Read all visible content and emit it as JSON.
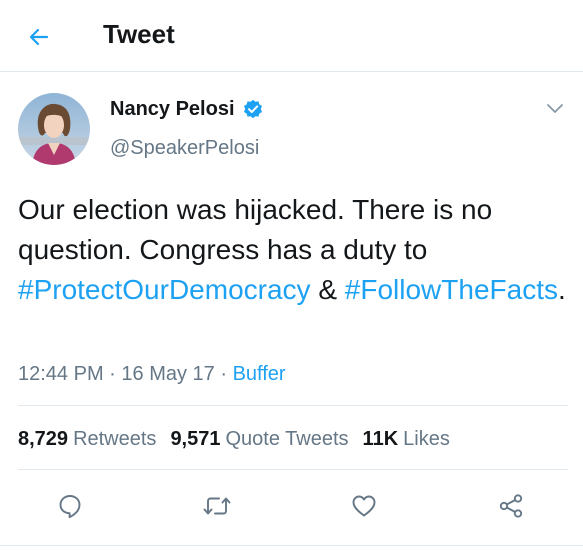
{
  "header": {
    "title": "Tweet",
    "back_icon": "arrow-left-icon"
  },
  "author": {
    "display_name": "Nancy Pelosi",
    "handle": "@SpeakerPelosi",
    "verified": true,
    "avatar_icon": "avatar-photo"
  },
  "tweet": {
    "text_part1": "Our election was hijacked. There is no question. Congress has a duty to ",
    "hashtag1": "#ProtectOurDemocracy",
    "text_part2": " & ",
    "hashtag2": "#FollowTheFacts",
    "text_part3": "."
  },
  "meta": {
    "time": "12:44 PM",
    "separator": " · ",
    "date": "16 May 17",
    "source": "Buffer"
  },
  "stats": {
    "retweets_count": "8,729",
    "retweets_label": "Retweets",
    "quotes_count": "9,571",
    "quotes_label": "Quote Tweets",
    "likes_count": "11K",
    "likes_label": "Likes"
  },
  "actions": [
    "reply-icon",
    "retweet-icon",
    "like-icon",
    "share-icon"
  ],
  "colors": {
    "accent": "#1da1f2",
    "text": "#14171a",
    "secondary": "#657786",
    "divider": "#e1e8ed"
  }
}
